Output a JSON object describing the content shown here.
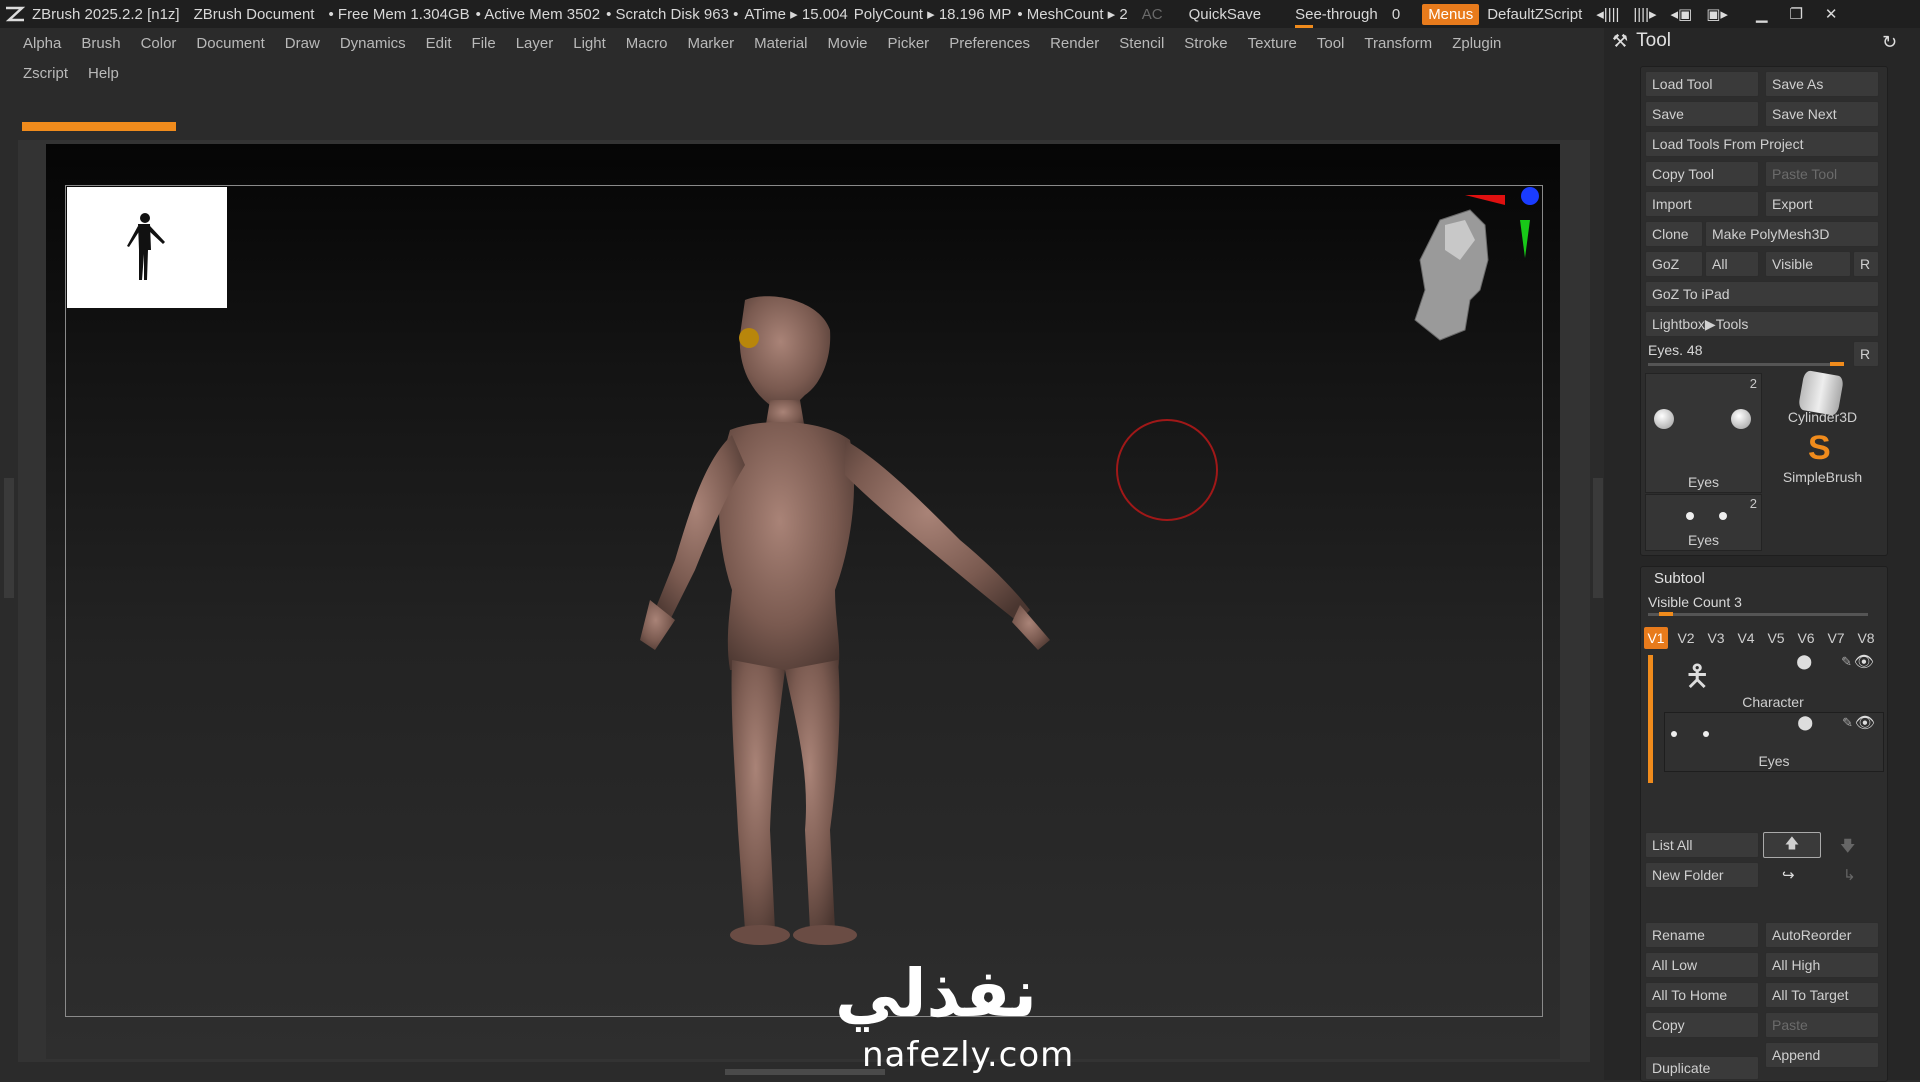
{
  "titlebar": {
    "app": "ZBrush 2025.2.2 [n1z]",
    "document": "ZBrush Document",
    "free_mem": "• Free Mem 1.304GB",
    "active_mem": "• Active Mem 3502",
    "scratch": "• Scratch Disk 963 •",
    "atime": "ATime ▸ 15.004",
    "polycount": "PolyCount ▸ 18.196 MP",
    "meshcount": "• MeshCount ▸ 2",
    "ac": "AC",
    "quicksave": "QuickSave",
    "seethrough": "See-through",
    "seethrough_value": "0",
    "menus": "Menus",
    "script": "DefaultZScript"
  },
  "menu": {
    "row1": [
      "Alpha",
      "Brush",
      "Color",
      "Document",
      "Draw",
      "Dynamics",
      "Edit",
      "File",
      "Layer",
      "Light",
      "Macro",
      "Marker",
      "Material",
      "Movie",
      "Picker",
      "Preferences",
      "Render",
      "Stencil",
      "Stroke",
      "Texture",
      "Tool",
      "Transform",
      "Zplugin"
    ],
    "row2": [
      "Zscript",
      "Help"
    ]
  },
  "progress_fraction": 0.08,
  "watermark": {
    "arabic": "نفذلي",
    "latin": "nafezly.com"
  },
  "tool_panel": {
    "title": "Tool",
    "buttons": {
      "load_tool": "Load Tool",
      "save_as": "Save As",
      "save": "Save",
      "save_next": "Save Next",
      "load_from_project": "Load Tools From Project",
      "copy_tool": "Copy Tool",
      "paste_tool": "Paste Tool",
      "import": "Import",
      "export": "Export",
      "clone": "Clone",
      "make_polymesh": "Make PolyMesh3D",
      "goz": "GoZ",
      "all": "All",
      "visible": "Visible",
      "r": "R",
      "goz_ipad": "GoZ To iPad",
      "lightbox": "Lightbox▶Tools"
    },
    "eyes_slider": {
      "label": "Eyes. 48",
      "r": "R"
    },
    "tools": [
      {
        "label": "Eyes",
        "count": "2"
      },
      {
        "label": "Cylinder3D"
      },
      {
        "label": "SimpleBrush"
      },
      {
        "label": "Eyes",
        "count": "2"
      }
    ]
  },
  "subtool": {
    "title": "Subtool",
    "visible_count": "Visible Count 3",
    "versions": [
      "V1",
      "V2",
      "V3",
      "V4",
      "V5",
      "V6",
      "V7",
      "V8"
    ],
    "items": [
      {
        "name": "Character"
      },
      {
        "name": "Eyes"
      }
    ],
    "buttons": {
      "list_all": "List All",
      "new_folder": "New Folder",
      "rename": "Rename",
      "autoreorder": "AutoReorder",
      "all_low": "All Low",
      "all_high": "All High",
      "all_to_home": "All To Home",
      "all_to_target": "All To Target",
      "copy": "Copy",
      "paste": "Paste",
      "duplicate": "Duplicate",
      "append": "Append"
    }
  },
  "colors": {
    "accent": "#f08b1c",
    "panel": "#262626",
    "button": "#3a3a3a"
  }
}
